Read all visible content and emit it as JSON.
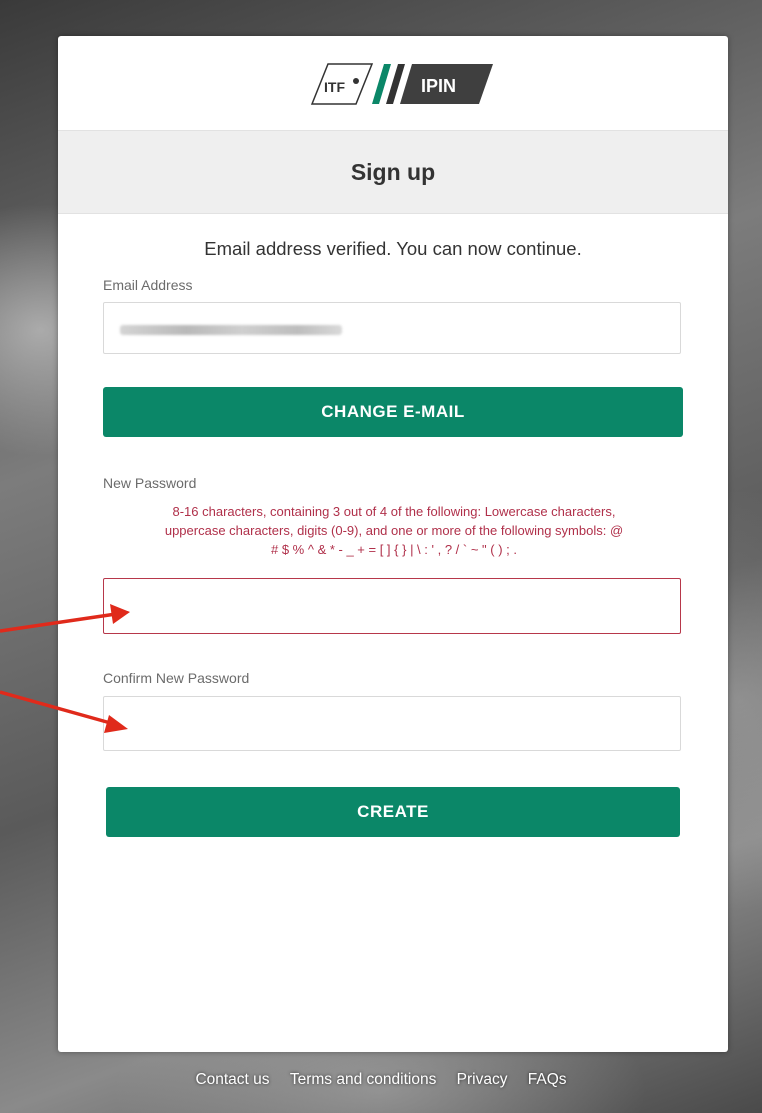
{
  "logo": {
    "itf_text": "ITF",
    "ipin_text": "IPIN"
  },
  "page_title": "Sign up",
  "verified_message": "Email address verified. You can now continue.",
  "email": {
    "label": "Email Address",
    "value": ""
  },
  "change_email_button": "CHANGE E-MAIL",
  "new_password": {
    "label": "New Password",
    "rules_line1": "8-16 characters, containing 3 out of 4 of the following: Lowercase characters,",
    "rules_line2": "uppercase characters, digits (0-9), and one or more of the following symbols: @",
    "rules_line3": "# $ % ^ & * - _ + = [ ] { } | \\ : ' , ? / ` ~ \" ( ) ; .",
    "value": ""
  },
  "confirm_password": {
    "label": "Confirm New Password",
    "value": ""
  },
  "create_button": "CREATE",
  "footer": {
    "contact": "Contact us",
    "terms": "Terms and conditions",
    "privacy": "Privacy",
    "faqs": "FAQs"
  },
  "colors": {
    "primary_button": "#0b8768",
    "error_text": "#b0304a",
    "annotation_arrow": "#e02a1b"
  }
}
